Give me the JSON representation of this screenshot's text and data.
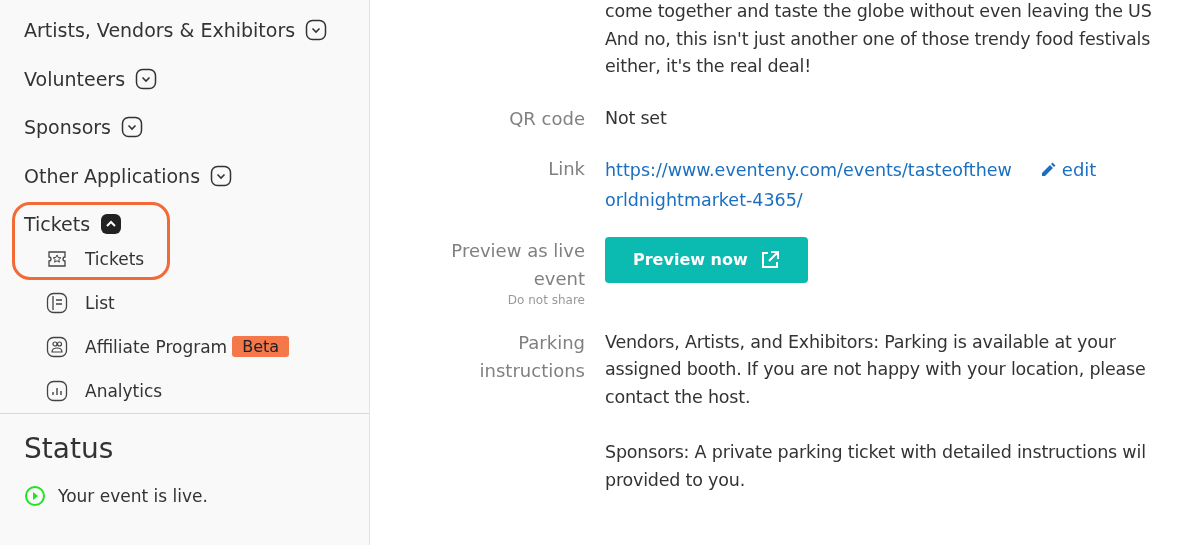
{
  "sidebar": {
    "menu": [
      {
        "label": "Artists, Vendors & Exhibitors",
        "expanded": false
      },
      {
        "label": "Volunteers",
        "expanded": false
      },
      {
        "label": "Sponsors",
        "expanded": false
      },
      {
        "label": "Other Applications",
        "expanded": false
      },
      {
        "label": "Tickets",
        "expanded": true,
        "highlighted": true,
        "children": [
          {
            "label": "Tickets"
          },
          {
            "label": "List"
          },
          {
            "label": "Affiliate Program",
            "badge": "Beta"
          },
          {
            "label": "Analytics"
          }
        ]
      }
    ],
    "status": {
      "title": "Status",
      "message": "Your event is live."
    }
  },
  "details": {
    "description_lines": [
      "come together and taste the globe without even leaving the US",
      "And no, this isn't just another one of those trendy food festivals",
      "either, it's the real deal!"
    ],
    "fields": [
      {
        "kind": "text",
        "label": "QR code",
        "value": "Not set"
      },
      {
        "kind": "link",
        "label": "Link",
        "url_lines": [
          "https://www.eventeny.com/events/tasteofthew",
          "orldnightmarket-4365/"
        ],
        "action": "edit"
      },
      {
        "kind": "button",
        "label_lines": [
          "Preview as live",
          "event"
        ],
        "note": "Do not share",
        "button": "Preview now"
      },
      {
        "kind": "paragraphs",
        "label_lines": [
          "Parking",
          "instructions"
        ],
        "paragraphs": [
          [
            "Vendors, Artists, and Exhibitors: Parking is available at your",
            "assigned booth. If you are not happy with your location, please",
            "contact the host."
          ],
          [
            "Sponsors: A private parking ticket with detailed instructions wil",
            "provided to you."
          ]
        ]
      }
    ]
  }
}
